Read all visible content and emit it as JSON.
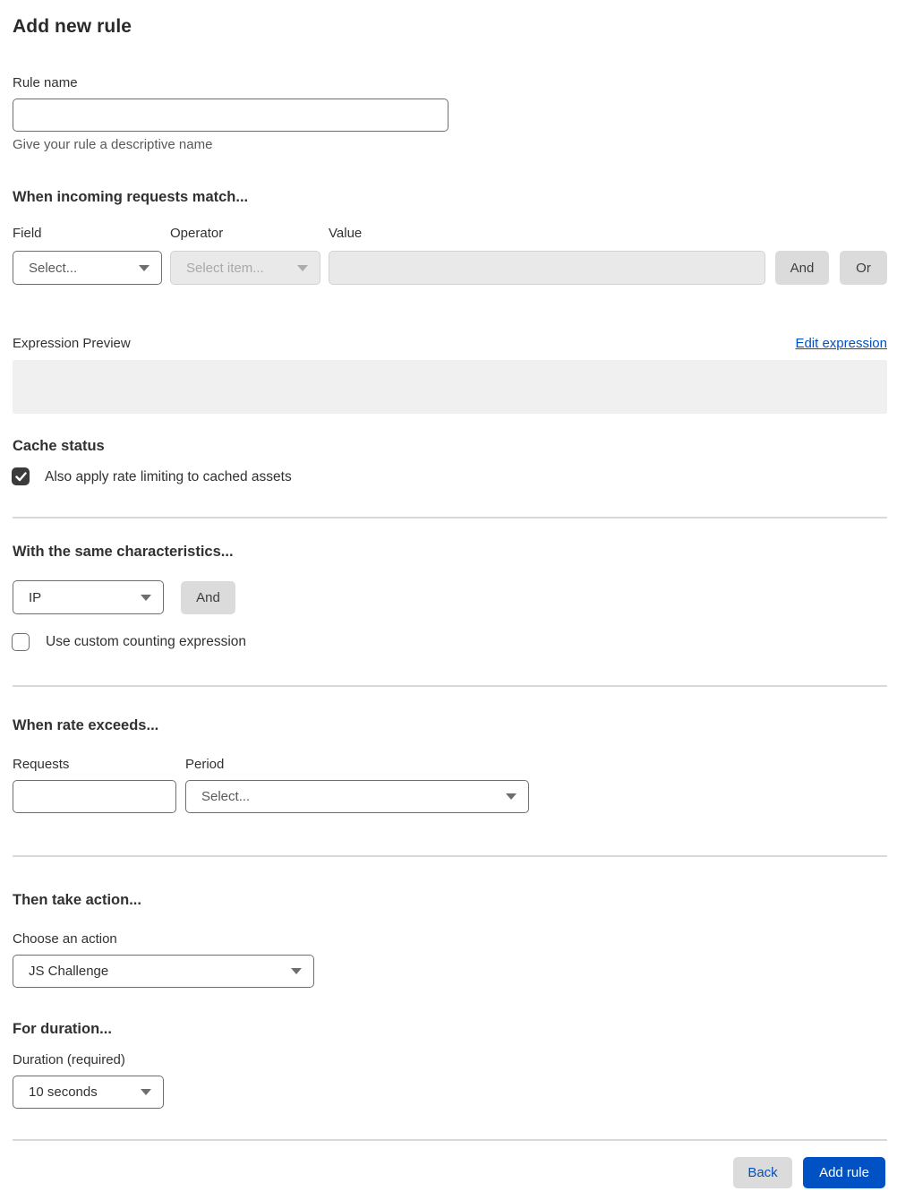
{
  "page": {
    "title": "Add new rule"
  },
  "rule_name": {
    "label": "Rule name",
    "value": "",
    "helper": "Give your rule a descriptive name"
  },
  "match": {
    "heading": "When incoming requests match...",
    "field_label": "Field",
    "field_placeholder": "Select...",
    "operator_label": "Operator",
    "operator_placeholder": "Select item...",
    "value_label": "Value",
    "value": "",
    "and_label": "And",
    "or_label": "Or"
  },
  "expression": {
    "label": "Expression Preview",
    "edit_link": "Edit expression",
    "preview": ""
  },
  "cache_status": {
    "heading": "Cache status",
    "checkbox_label": "Also apply rate limiting to cached assets",
    "checked": true
  },
  "characteristics": {
    "heading": "With the same characteristics...",
    "selected_value": "IP",
    "and_label": "And",
    "checkbox_label": "Use custom counting expression",
    "checked": false
  },
  "rate": {
    "heading": "When rate exceeds...",
    "requests_label": "Requests",
    "requests_value": "",
    "period_label": "Period",
    "period_placeholder": "Select..."
  },
  "action": {
    "heading": "Then take action...",
    "choose_label": "Choose an action",
    "selected_value": "JS Challenge"
  },
  "duration": {
    "heading": "For duration...",
    "label": "Duration (required)",
    "selected_value": "10 seconds"
  },
  "footer": {
    "back_label": "Back",
    "add_label": "Add rule"
  },
  "colors": {
    "accent_blue": "#0051c3",
    "text_dark": "#313131",
    "text_muted": "#595959",
    "disabled_bg": "#e9e9e9",
    "button_gray": "#dbdbdb",
    "divider": "#d9d9d9",
    "preview_bg": "#f0f0f0",
    "checkbox_checked": "#3b3b3b"
  }
}
